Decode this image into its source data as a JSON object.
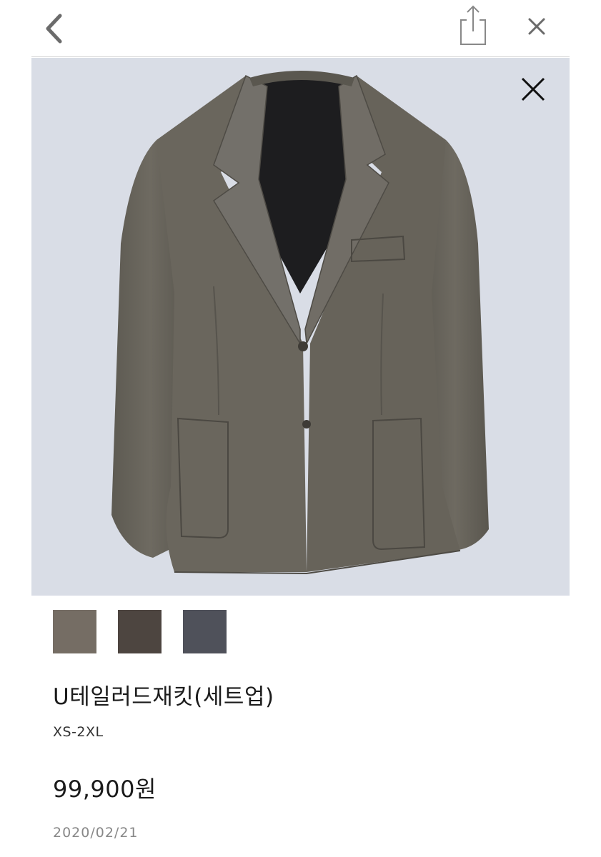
{
  "header": {
    "back_icon": "chevron-left-icon",
    "share_icon": "share-icon",
    "close_icon": "close-icon"
  },
  "hero": {
    "image_subject": "charcoal-olive tailored jacket on light gray background",
    "close_icon": "close-icon",
    "background_color": "#d9dde6"
  },
  "swatches": [
    {
      "name": "olive-gray",
      "color": "#756d64"
    },
    {
      "name": "dark-brown",
      "color": "#4d4540"
    },
    {
      "name": "charcoal-navy",
      "color": "#4f515a"
    }
  ],
  "product": {
    "name": "U테일러드재킷(세트업)",
    "sizes": "XS-2XL",
    "price": "99,900원",
    "date": "2020/02/21"
  }
}
